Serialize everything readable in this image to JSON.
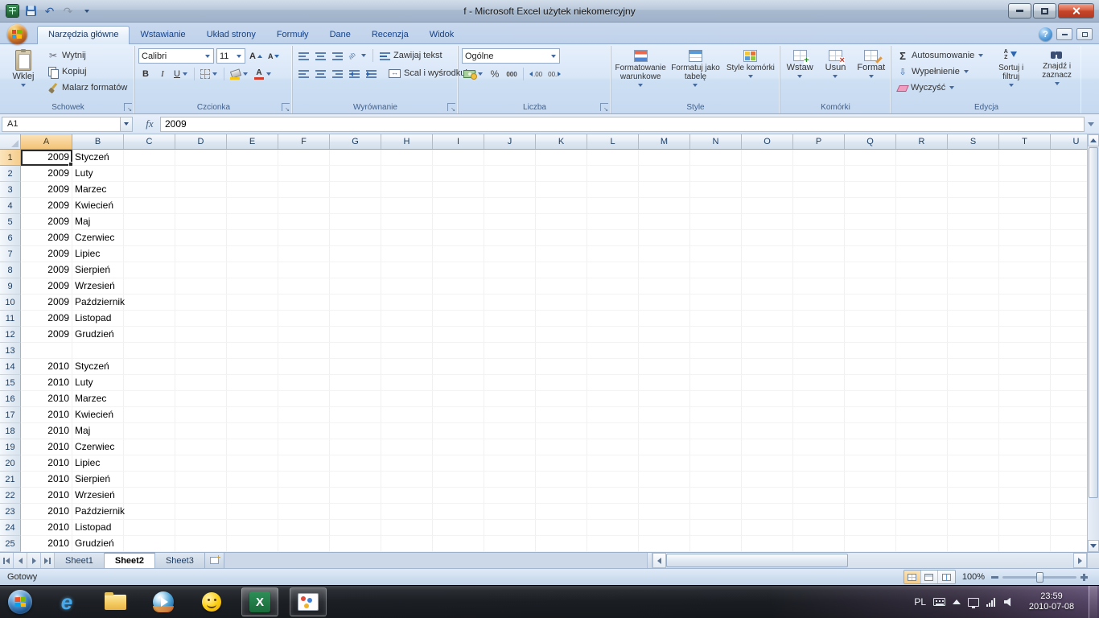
{
  "window": {
    "title": "f - Microsoft Excel użytek niekomercyjny"
  },
  "ribbon": {
    "help": "?",
    "tabs": [
      {
        "label": "Narzędzia główne",
        "active": true
      },
      {
        "label": "Wstawianie",
        "active": false
      },
      {
        "label": "Układ strony",
        "active": false
      },
      {
        "label": "Formuły",
        "active": false
      },
      {
        "label": "Dane",
        "active": false
      },
      {
        "label": "Recenzja",
        "active": false
      },
      {
        "label": "Widok",
        "active": false
      }
    ],
    "clipboard": {
      "label": "Schowek",
      "paste": "Wklej",
      "cut": "Wytnij",
      "copy": "Kopiuj",
      "format_painter": "Malarz formatów"
    },
    "font": {
      "label": "Czcionka",
      "font_name": "Calibri",
      "font_size": "11",
      "bold": "B",
      "italic": "I",
      "underline": "U"
    },
    "alignment": {
      "label": "Wyrównanie",
      "wrap_text": "Zawijaj tekst",
      "merge_center": "Scal i wyśrodkuj"
    },
    "number": {
      "label": "Liczba",
      "format": "Ogólne",
      "percent": "%",
      "thousands": "000",
      "inc_decimal": ".00",
      "dec_decimal": "00."
    },
    "styles": {
      "label": "Style",
      "conditional": "Formatowanie warunkowe",
      "format_table": "Formatuj jako tabelę",
      "cell_styles": "Style komórki"
    },
    "cells": {
      "label": "Komórki",
      "insert": "Wstaw",
      "delete": "Usuń",
      "format": "Format"
    },
    "editing": {
      "label": "Edycja",
      "sigma": "Σ",
      "autosum": "Autosumowanie",
      "fill": "Wypełnienie",
      "clear": "Wyczyść",
      "sort_filter": "Sortuj i filtruj",
      "find_select": "Znajdź i zaznacz"
    }
  },
  "formula_bar": {
    "name_box": "A1",
    "fx": "fx",
    "value": "2009"
  },
  "grid": {
    "columns": [
      "A",
      "B",
      "C",
      "D",
      "E",
      "F",
      "G",
      "H",
      "I",
      "J",
      "K",
      "L",
      "M",
      "N",
      "O",
      "P",
      "Q",
      "R",
      "S",
      "T",
      "U"
    ],
    "selected": {
      "cell": "A1",
      "column": "A",
      "row": 1
    },
    "rows": [
      {
        "n": 1,
        "A": "2009",
        "B": "Styczeń"
      },
      {
        "n": 2,
        "A": "2009",
        "B": "Luty"
      },
      {
        "n": 3,
        "A": "2009",
        "B": "Marzec"
      },
      {
        "n": 4,
        "A": "2009",
        "B": "Kwiecień"
      },
      {
        "n": 5,
        "A": "2009",
        "B": "Maj"
      },
      {
        "n": 6,
        "A": "2009",
        "B": "Czerwiec"
      },
      {
        "n": 7,
        "A": "2009",
        "B": "Lipiec"
      },
      {
        "n": 8,
        "A": "2009",
        "B": "Sierpień"
      },
      {
        "n": 9,
        "A": "2009",
        "B": "Wrzesień"
      },
      {
        "n": 10,
        "A": "2009",
        "B": "Październik"
      },
      {
        "n": 11,
        "A": "2009",
        "B": "Listopad"
      },
      {
        "n": 12,
        "A": "2009",
        "B": "Grudzień"
      },
      {
        "n": 13,
        "A": "",
        "B": ""
      },
      {
        "n": 14,
        "A": "2010",
        "B": "Styczeń"
      },
      {
        "n": 15,
        "A": "2010",
        "B": "Luty"
      },
      {
        "n": 16,
        "A": "2010",
        "B": "Marzec"
      },
      {
        "n": 17,
        "A": "2010",
        "B": "Kwiecień"
      },
      {
        "n": 18,
        "A": "2010",
        "B": "Maj"
      },
      {
        "n": 19,
        "A": "2010",
        "B": "Czerwiec"
      },
      {
        "n": 20,
        "A": "2010",
        "B": "Lipiec"
      },
      {
        "n": 21,
        "A": "2010",
        "B": "Sierpień"
      },
      {
        "n": 22,
        "A": "2010",
        "B": "Wrzesień"
      },
      {
        "n": 23,
        "A": "2010",
        "B": "Październik"
      },
      {
        "n": 24,
        "A": "2010",
        "B": "Listopad"
      },
      {
        "n": 25,
        "A": "2010",
        "B": "Grudzień"
      }
    ]
  },
  "sheets": {
    "tabs": [
      {
        "label": "Sheet1",
        "active": false
      },
      {
        "label": "Sheet2",
        "active": true
      },
      {
        "label": "Sheet3",
        "active": false
      }
    ]
  },
  "status_bar": {
    "ready": "Gotowy",
    "zoom": "100%"
  },
  "taskbar": {
    "language": "PL",
    "time": "23:59",
    "date": "2010-07-08"
  }
}
